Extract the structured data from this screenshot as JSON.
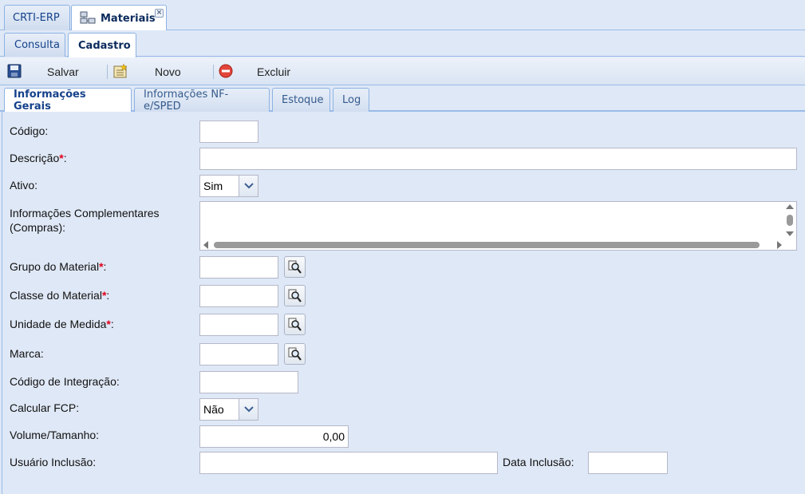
{
  "app_tabs": {
    "erp_label": "CRTI-ERP",
    "materiais_label": "Materiais",
    "close_glyph": "×"
  },
  "sub_tabs": {
    "consulta": "Consulta",
    "cadastro": "Cadastro"
  },
  "toolbar": {
    "save_label": "Salvar",
    "new_label": "Novo",
    "delete_label": "Excluir"
  },
  "form_tabs": {
    "gerais": "Informações Gerais",
    "nfe": "Informações NF-e/SPED",
    "estoque": "Estoque",
    "log": "Log"
  },
  "form": {
    "codigo_label": "Código:",
    "codigo_value": "",
    "descricao_label": "Descrição",
    "descricao_value": "",
    "ativo_label": "Ativo:",
    "ativo_value": "Sim",
    "info_comp_label_1": "Informações Complementares",
    "info_comp_label_2": "(Compras):",
    "info_comp_value": "",
    "grupo_label": "Grupo do Material",
    "grupo_value": "",
    "classe_label": "Classe do Material",
    "classe_value": "",
    "unidade_label": "Unidade de Medida",
    "unidade_value": "",
    "marca_label": "Marca:",
    "marca_value": "",
    "integracao_label": "Código de Integração:",
    "integracao_value": "",
    "fcp_label": "Calcular FCP:",
    "fcp_value": "Não",
    "volume_label": "Volume/Tamanho:",
    "volume_value": "0,00",
    "usuario_label": "Usuário Inclusão:",
    "usuario_value": "",
    "data_label": "Data Inclusão:",
    "data_value": "",
    "required_mark": "*",
    "colon": ":"
  },
  "icons": {
    "save": "floppy-disk-icon",
    "new": "new-document-icon",
    "delete": "delete-circle-icon",
    "lookup": "magnifier-icon",
    "module": "grid-module-icon",
    "dropdown": "chevron-down-icon"
  },
  "colors": {
    "header_blue": "#dfe8f6",
    "border_blue": "#99bbe8",
    "tab_text": "#15428b",
    "required": "#e0001a"
  }
}
